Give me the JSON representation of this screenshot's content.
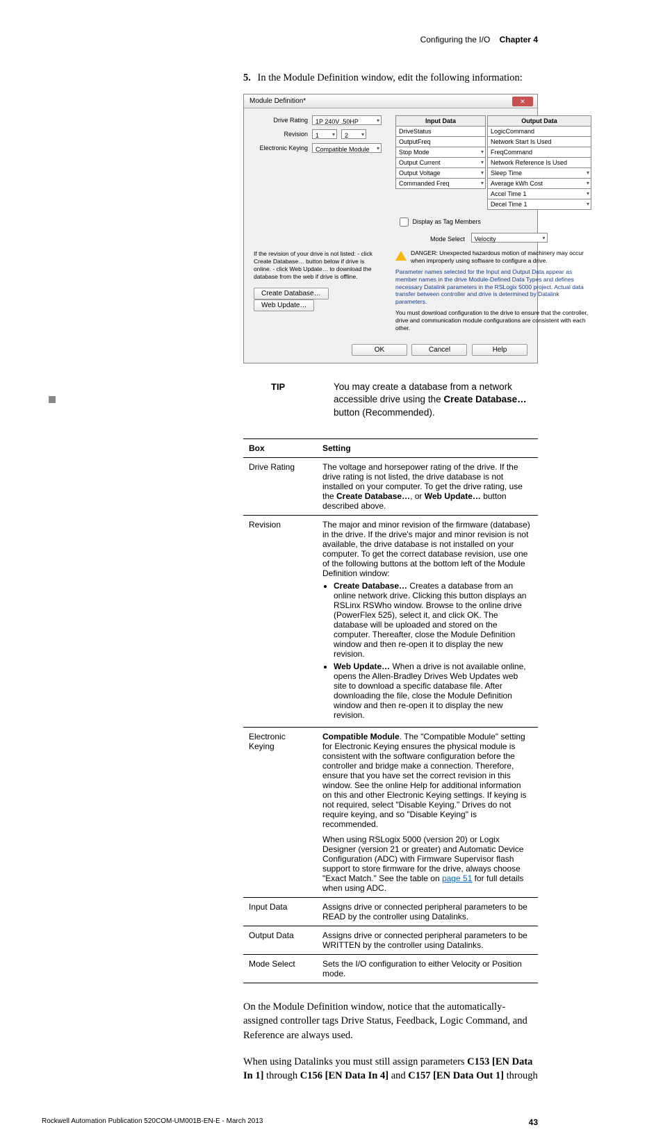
{
  "header": {
    "breadcrumb_left": "Configuring the I/O",
    "breadcrumb_right": "Chapter 4"
  },
  "step": {
    "number": "5.",
    "text": "In the Module Definition window, edit the following information:"
  },
  "dialog": {
    "title": "Module Definition*",
    "drive_rating_label": "Drive Rating",
    "drive_rating_value": "1P 240V    .50HP",
    "revision_label": "Revision",
    "revision_major": "1",
    "revision_minor": "2",
    "ekey_label": "Electronic Keying",
    "ekey_value": "Compatible Module",
    "input_header": "Input Data",
    "output_header": "Output Data",
    "input_rows": [
      "DriveStatus",
      "OutputFreq",
      "Stop Mode",
      "Output Current",
      "Output Voltage",
      "Commanded Freq"
    ],
    "output_rows": [
      "LogicCommand",
      "Network Start Is Used",
      "FreqCommand",
      "Network Reference Is Used",
      "Sleep Time",
      "Average kWh Cost",
      "Accel Time 1",
      "Decel Time 1"
    ],
    "display_tag": "Display as Tag Members",
    "mode_label": "Mode Select",
    "mode_value": "Velocity",
    "danger": "DANGER: Unexpected hazardous motion of machinery may occur when improperly using software to configure a drive.",
    "param_note": "Parameter names selected for the Input and Output Data appear as member names in the drive Module-Defined Data Types and defines necessary Datalink parameters in the RSLogix 5000 project. Actual data transfer between controller and drive is determined by Datalink parameters.",
    "download_note": "You must download configuration to the drive to ensure that the controller, drive and communication module configurations are consistent with each other.",
    "left_note": "If the revision of your drive is not listed:\n- click Create Database… button below if drive is online.\n- click Web Update… to download the database from the web if drive is offline.",
    "create_btn": "Create Database…",
    "web_btn": "Web Update…",
    "ok": "OK",
    "cancel": "Cancel",
    "help": "Help"
  },
  "tip": {
    "label": "TIP",
    "text_pre": "You may create a database from a network accessible drive using the ",
    "bold": "Create Database…",
    "text_post": " button (Recommended)."
  },
  "table": {
    "h1": "Box",
    "h2": "Setting",
    "rows": [
      {
        "box": "Drive Rating",
        "setting": "The voltage and horsepower rating of the drive. If the drive rating is not listed, the drive database is not installed on your computer. To get the drive rating, use the <strong>Create Database…</strong>, or <strong>Web Update…</strong> button described above."
      },
      {
        "box": "Revision",
        "setting": "The major and minor revision of the firmware (database) in the drive. If the drive's major and minor revision is not available, the drive database is not installed on your computer. To get the correct database revision, use one of the following buttons at the bottom left of the Module Definition window:<ul><li><strong>Create Database…</strong> Creates a database from an online network drive. Clicking this button displays an RSLinx RSWho window. Browse to the online drive (PowerFlex 525), select it, and click OK. The database will be uploaded and stored on the computer. Thereafter, close the Module Definition window and then re-open it to display the new revision.</li><li><strong>Web Update…</strong> When a drive is not available online, opens the Allen-Bradley Drives Web Updates web site to download a specific database file. After downloading the file, close the Module Definition window and then re-open it to display the new revision.</li></ul>"
      },
      {
        "box": "Electronic Keying",
        "setting": "<strong>Compatible Module</strong>. The \"Compatible Module\" setting for Electronic Keying ensures the physical module is consistent with the software configuration before the controller and bridge make a connection. Therefore, ensure that you have set the correct revision in this window. See the online Help for additional information on this and other Electronic Keying settings. If keying is not required, select \"Disable Keying.\" Drives do not require keying, and so \"Disable Keying\" is recommended.<div class='sub-para'>When using RSLogix 5000 (version 20) or Logix Designer (version 21 or greater) and Automatic Device Configuration (ADC) with Firmware Supervisor flash support to store firmware for the drive, always choose \"Exact Match.\" See the table on <a class='link' href='#'>page 51</a> for full details when using ADC.</div>"
      },
      {
        "box": "Input Data",
        "setting": "Assigns drive or connected peripheral parameters to be READ by the controller using Datalinks."
      },
      {
        "box": "Output Data",
        "setting": "Assigns drive or connected peripheral parameters to be WRITTEN by the controller using Datalinks."
      },
      {
        "box": "Mode Select",
        "setting": "Sets the I/O configuration to either Velocity or Position mode."
      }
    ]
  },
  "para1": "On the Module Definition window, notice that the automatically-assigned controller tags Drive Status, Feedback, Logic Command, and Reference are always used.",
  "para2_pre": "When using Datalinks you must still assign parameters ",
  "para2_b1": "C153 [EN Data In 1]",
  "para2_mid1": " through ",
  "para2_b2": "C156 [EN Data In 4]",
  "para2_mid2": " and ",
  "para2_b3": "C157 [EN Data Out 1]",
  "para2_post": " through",
  "footer": {
    "pub": "Rockwell Automation Publication 520COM-UM001B-EN-E - March 2013",
    "page": "43"
  }
}
